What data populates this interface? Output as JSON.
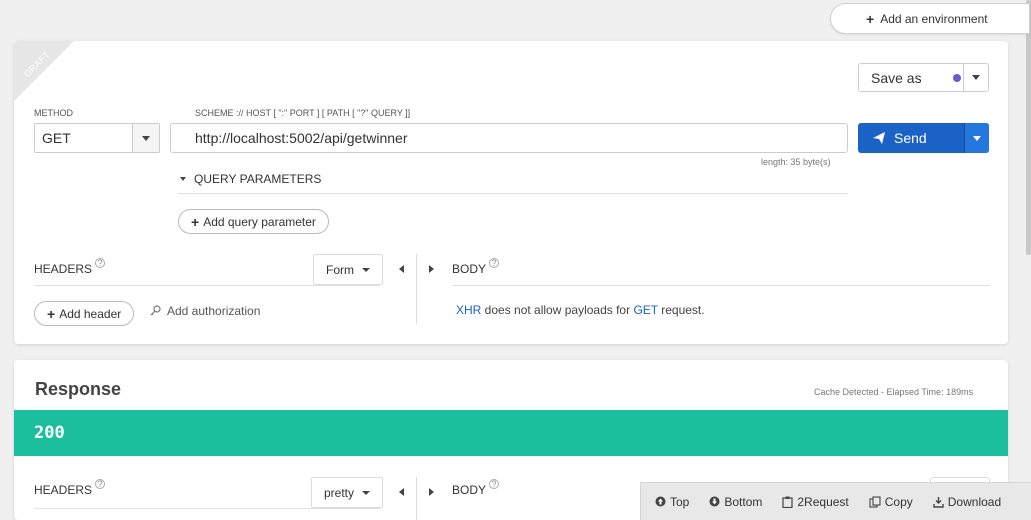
{
  "environment": {
    "add_label": "Add an environment"
  },
  "draft": {
    "label": "DRAFT"
  },
  "request": {
    "method_label": "METHOD",
    "method_value": "GET",
    "scheme_label": "SCHEME :// HOST [ \":\" PORT ] [ PATH [ \"?\" QUERY ]]",
    "url": "http://localhost:5002/api/getwinner",
    "length": "length: 35 byte(s)",
    "save_as": "Save as",
    "send": "Send",
    "query_params_label": "QUERY PARAMETERS",
    "add_query_param": "Add query parameter",
    "headers_label": "HEADERS",
    "headers_mode": "Form",
    "add_header": "Add header",
    "add_authorization": "Add authorization",
    "body_label": "BODY",
    "body_msg_xhr": "XHR",
    "body_msg_mid": " does not allow payloads for ",
    "body_msg_get": "GET",
    "body_msg_end": " request."
  },
  "response": {
    "title": "Response",
    "meta": "Cache Detected - Elapsed Time: 189ms",
    "status": "200",
    "headers_label": "HEADERS",
    "headers_mode": "pretty",
    "body_label": "BODY"
  },
  "bottom_bar": {
    "top": "Top",
    "bottom": "Bottom",
    "to_request": "2Request",
    "copy": "Copy",
    "download": "Download"
  },
  "colors": {
    "send": "#1a62c6",
    "status_ok": "#1bbf9e",
    "saveas_dot": "#6a5acd"
  }
}
